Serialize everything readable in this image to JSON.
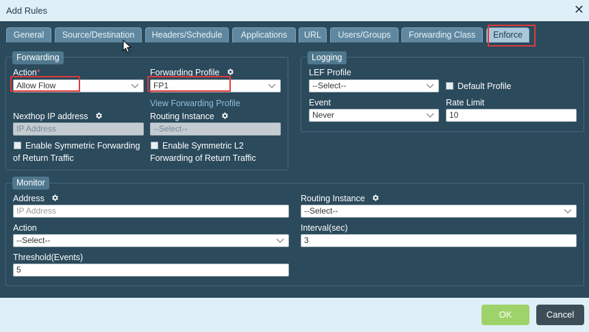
{
  "dialog": {
    "title": "Add Rules"
  },
  "tabs": [
    {
      "label": "General"
    },
    {
      "label": "Source/Destination"
    },
    {
      "label": "Headers/Schedule"
    },
    {
      "label": "Applications"
    },
    {
      "label": "URL"
    },
    {
      "label": "Users/Groups"
    },
    {
      "label": "Forwarding Class"
    },
    {
      "label": "Enforce"
    }
  ],
  "active_tab": "Enforce",
  "forwarding": {
    "legend": "Forwarding",
    "action_label": "Action",
    "action_required": "*",
    "action_value": "Allow Flow",
    "profile_label": "Forwarding Profile",
    "profile_value": "FP1",
    "view_profile_link": "View Forwarding Profile",
    "nexthop_label": "Nexthop IP address",
    "nexthop_placeholder": "IP Address",
    "routing_label": "Routing Instance",
    "routing_value": "--Select--",
    "sym_fwd_line1": "Enable Symmetric Forwarding",
    "sym_fwd_line2": "of Return Traffic",
    "sym_l2_line1": "Enable Symmetric L2",
    "sym_l2_line2": "Forwarding of Return Traffic"
  },
  "logging": {
    "legend": "Logging",
    "lef_label": "LEF Profile",
    "lef_value": "--Select--",
    "default_profile_label": "Default Profile",
    "event_label": "Event",
    "event_value": "Never",
    "rate_label": "Rate Limit",
    "rate_value": "10"
  },
  "monitor": {
    "legend": "Monitor",
    "address_label": "Address",
    "address_placeholder": "IP Address",
    "routing_label": "Routing Instance",
    "routing_value": "--Select--",
    "action_label": "Action",
    "action_value": "--Select--",
    "interval_label": "Interval(sec)",
    "interval_value": "3",
    "threshold_label": "Threshold(Events)",
    "threshold_value": "5"
  },
  "footer": {
    "ok_label": "OK",
    "cancel_label": "Cancel"
  },
  "colors": {
    "background": "#2b4a5c",
    "accent_ok": "#9ed36a",
    "highlight": "#e0393a",
    "link": "#8fc0dd"
  },
  "icons": {
    "gear": "gear-icon",
    "chevron": "chevron-down-icon",
    "close": "close-icon"
  }
}
